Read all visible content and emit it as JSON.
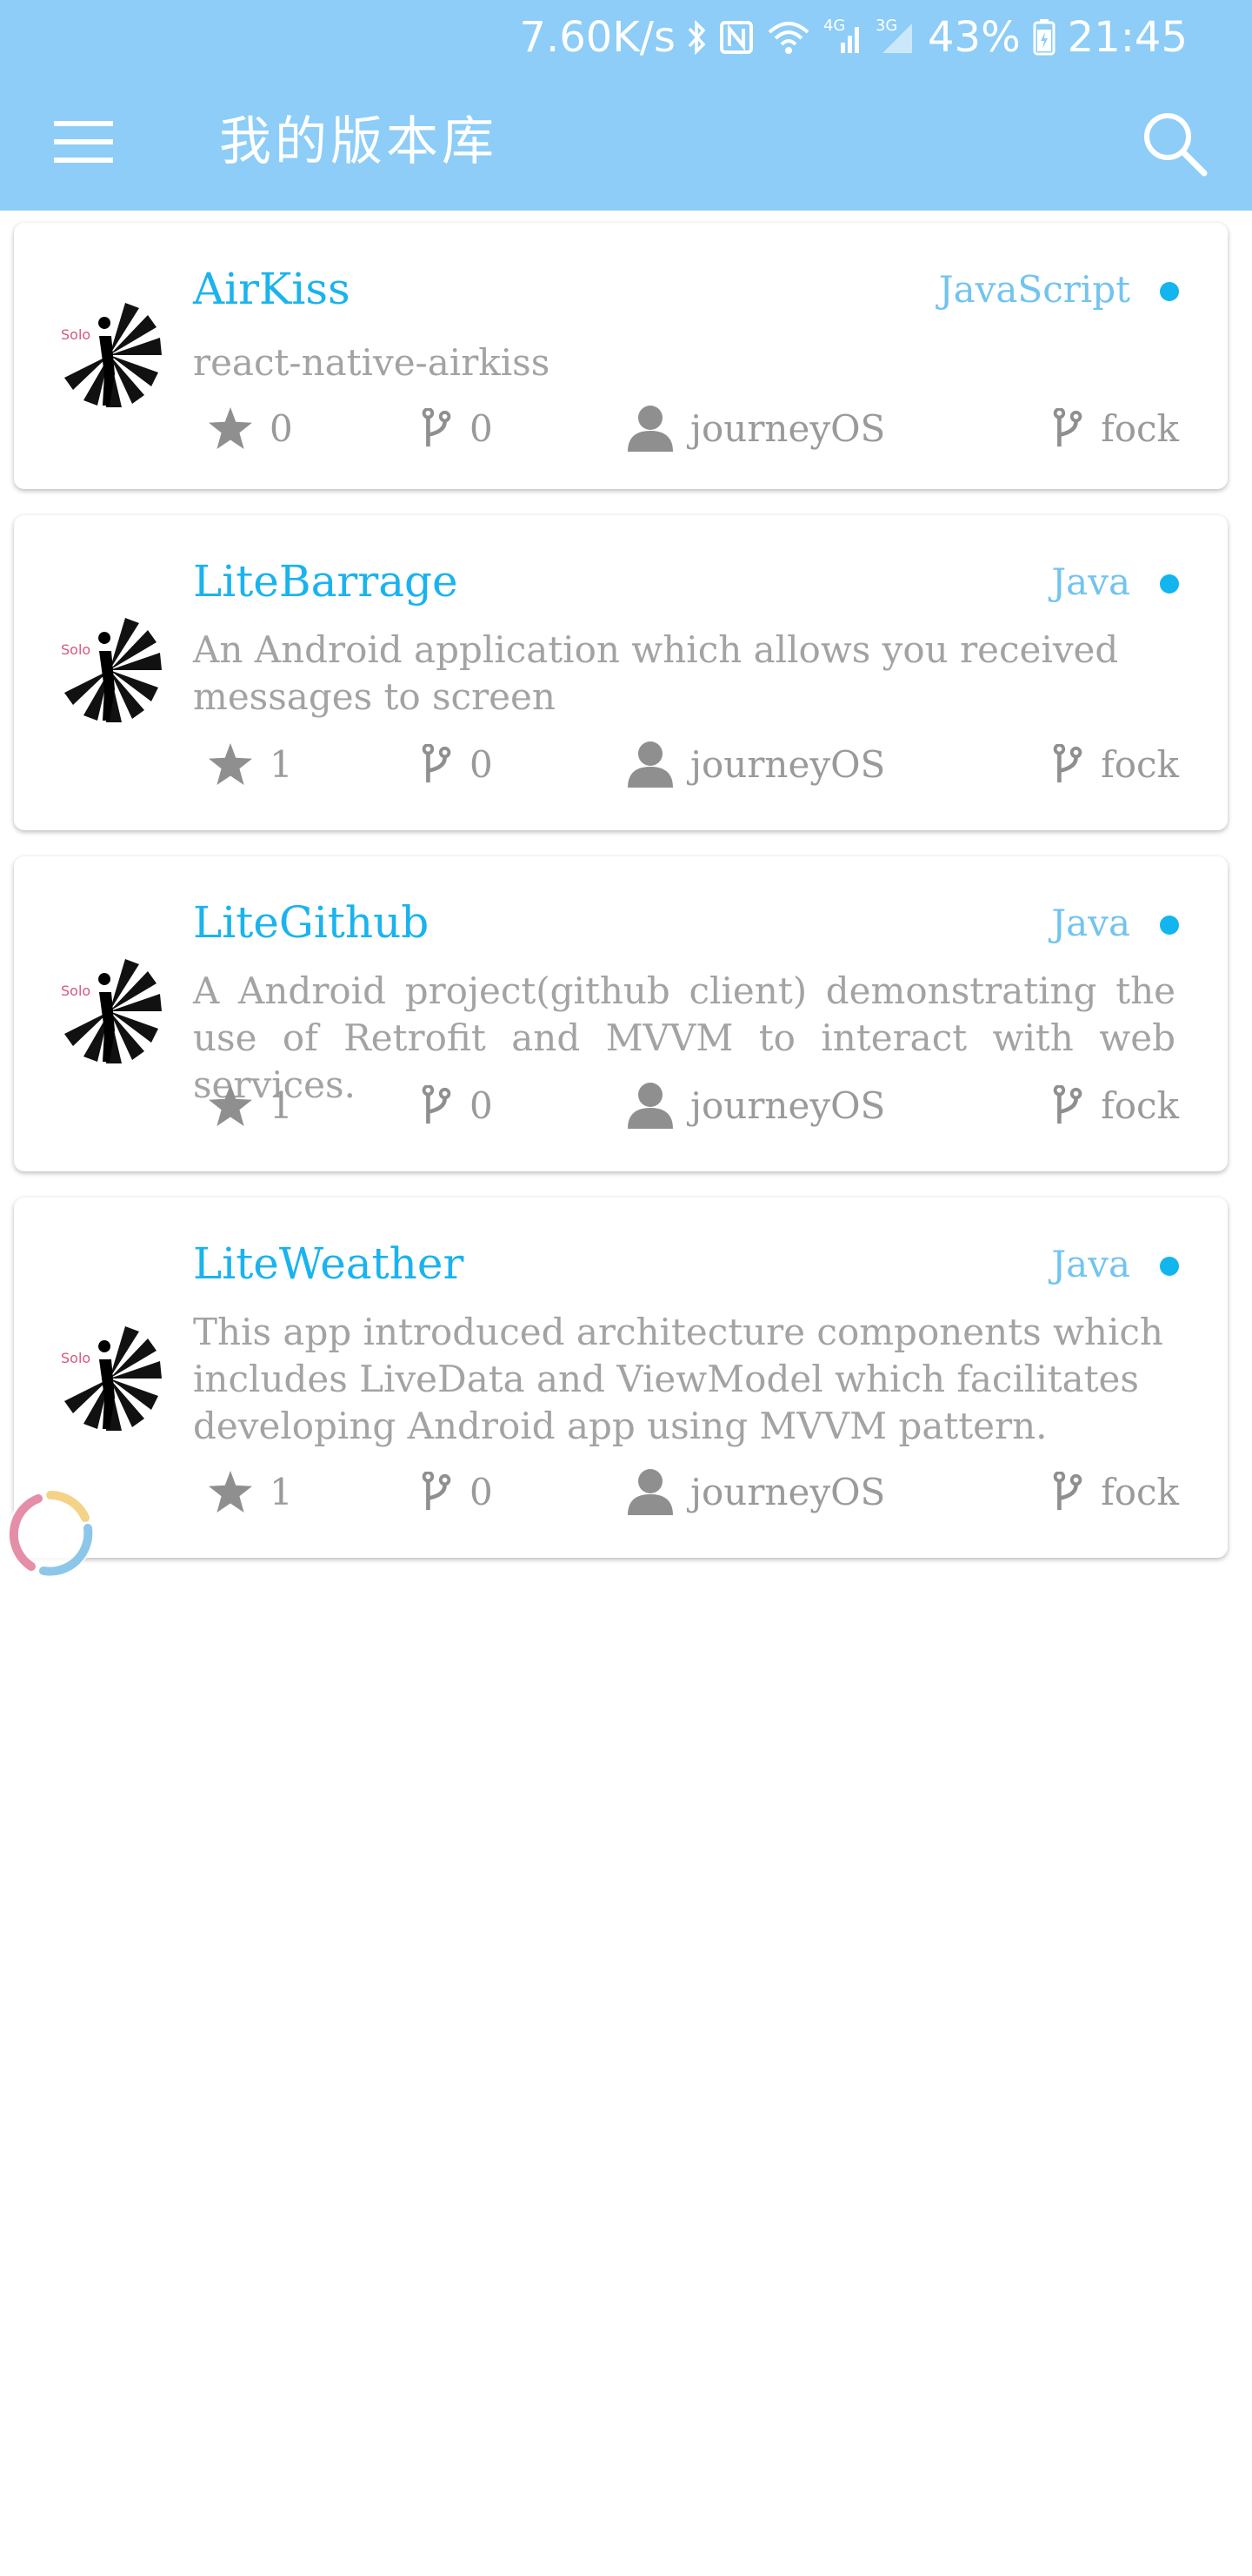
{
  "status_bar": {
    "net_speed": "7.60K/s",
    "network_4g": "4G",
    "network_3g": "3G",
    "battery": "43%",
    "time": "21:45",
    "icons": [
      "bluetooth-icon",
      "nfc-icon",
      "wifi-icon",
      "signal-4g-icon",
      "signal-3g-icon",
      "battery-icon"
    ]
  },
  "toolbar": {
    "title": "我的版本库",
    "menu_icon": "hamburger-menu-icon",
    "search_icon": "search-icon"
  },
  "colors": {
    "header": "#8dcdf7",
    "repo_name": "#1ab3ee",
    "language": "#72c4ef",
    "language_dot": "#13b5ef",
    "meta_text": "#9a9a9a"
  },
  "repos": [
    {
      "name": "AirKiss",
      "language": "JavaScript",
      "description": "react-native-airkiss",
      "stars": "0",
      "forks": "0",
      "owner": "journeyOS",
      "fork_label": "fock",
      "avatar_text": "Solo"
    },
    {
      "name": "LiteBarrage",
      "language": "Java",
      "description": "An Android application which allows you received messages to screen",
      "stars": "1",
      "forks": "0",
      "owner": "journeyOS",
      "fork_label": "fock",
      "avatar_text": "Solo"
    },
    {
      "name": "LiteGithub",
      "language": "Java",
      "description": "A Android project(github client) demonstrating the use of Retrofit and MVVM to interact with web services.",
      "stars": "1",
      "forks": "0",
      "owner": "journeyOS",
      "fork_label": "fock",
      "avatar_text": "Solo"
    },
    {
      "name": "LiteWeather",
      "language": "Java",
      "description": "This app introduced architecture components which includes LiveData and ViewModel which facilitates developing Android app using MVVM pattern.",
      "stars": "1",
      "forks": "0",
      "owner": "journeyOS",
      "fork_label": "fock",
      "avatar_text": "Solo"
    }
  ]
}
